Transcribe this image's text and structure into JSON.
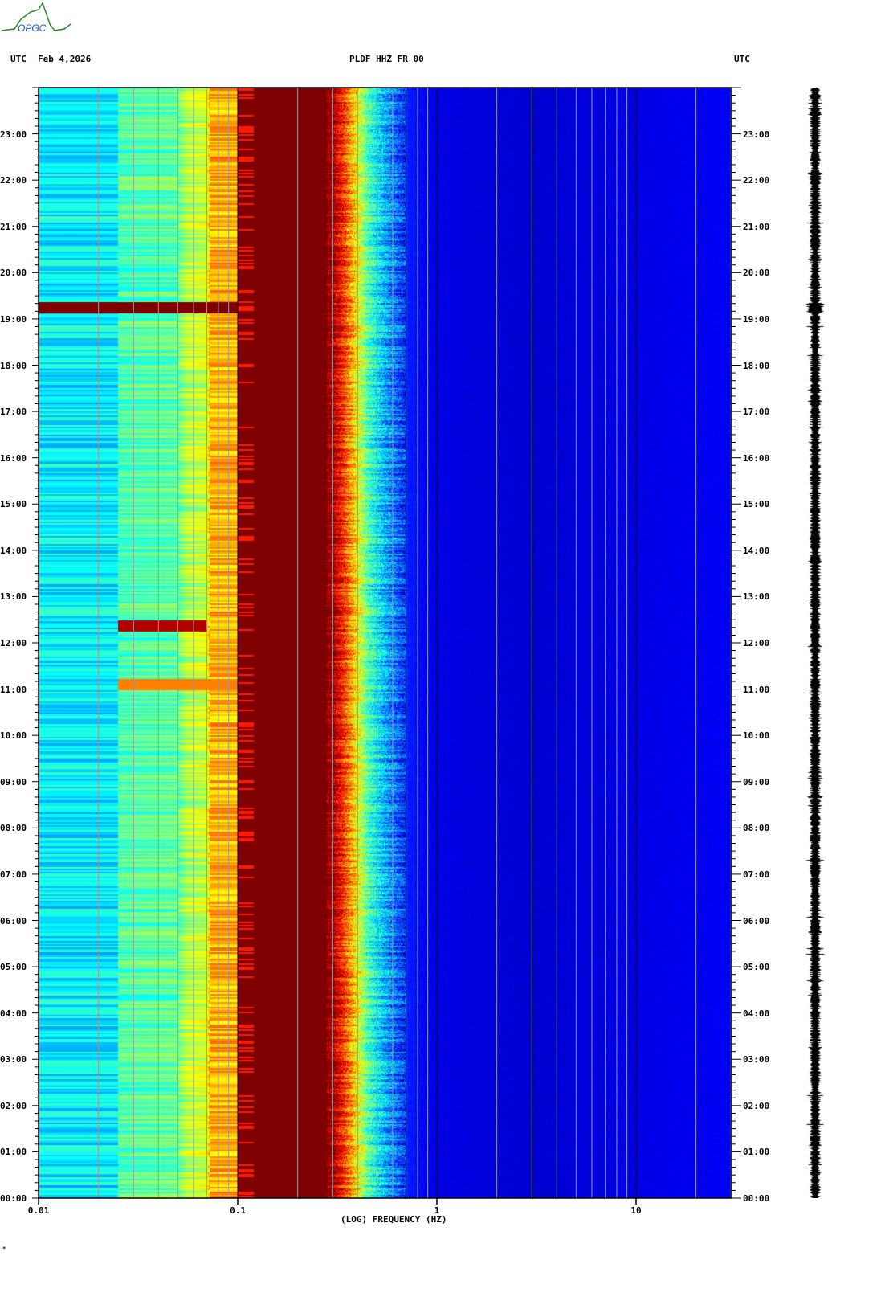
{
  "header": {
    "logo_text": "OPGC",
    "left_label": "UTC",
    "date": "Feb 4,2026",
    "station": "PLDF HHZ FR 00",
    "right_label": "UTC"
  },
  "footer_mark": "*",
  "chart_data": {
    "type": "heatmap",
    "title": "PLDF HHZ FR 00",
    "xlabel": "(LOG) FREQUENCY (HZ)",
    "ylabel": "UTC",
    "x_scale": "log",
    "xlim": [
      0.01,
      30
    ],
    "x_ticks": [
      "0.01",
      "0.1",
      "1",
      "10"
    ],
    "x_tick_values": [
      0.01,
      0.1,
      1,
      10
    ],
    "ylim_hours": [
      0,
      24
    ],
    "y_ticks": [
      "00:00",
      "01:00",
      "02:00",
      "03:00",
      "04:00",
      "05:00",
      "06:00",
      "07:00",
      "08:00",
      "09:00",
      "10:00",
      "11:00",
      "12:00",
      "13:00",
      "14:00",
      "15:00",
      "16:00",
      "17:00",
      "18:00",
      "19:00",
      "20:00",
      "21:00",
      "22:00",
      "23:00"
    ],
    "colormap": "jet",
    "spectral_profile": [
      {
        "f": 0.01,
        "level": 0.36
      },
      {
        "f": 0.0249,
        "level": 0.36
      },
      {
        "f": 0.025,
        "level": 0.45
      },
      {
        "f": 0.05,
        "level": 0.47
      },
      {
        "f": 0.055,
        "level": 0.55
      },
      {
        "f": 0.07,
        "level": 0.58
      },
      {
        "f": 0.072,
        "level": 0.7
      },
      {
        "f": 0.099,
        "level": 0.7
      },
      {
        "f": 0.1,
        "level": 1.0
      },
      {
        "f": 0.29,
        "level": 1.0
      },
      {
        "f": 0.33,
        "level": 0.86
      },
      {
        "f": 0.38,
        "level": 0.68
      },
      {
        "f": 0.45,
        "level": 0.45
      },
      {
        "f": 0.55,
        "level": 0.3
      },
      {
        "f": 0.7,
        "level": 0.16
      },
      {
        "f": 1.0,
        "level": 0.1
      },
      {
        "f": 3.0,
        "level": 0.08
      },
      {
        "f": 10,
        "level": 0.1
      },
      {
        "f": 30,
        "level": 0.12
      }
    ],
    "events": [
      {
        "time_hours": 19.25,
        "fmin": 0.01,
        "fmax": 0.1,
        "level": 1.0
      },
      {
        "time_hours": 12.38,
        "fmin": 0.025,
        "fmax": 0.07,
        "level": 0.95
      },
      {
        "time_hours": 11.1,
        "fmin": 0.025,
        "fmax": 0.1,
        "level": 0.75
      }
    ]
  }
}
